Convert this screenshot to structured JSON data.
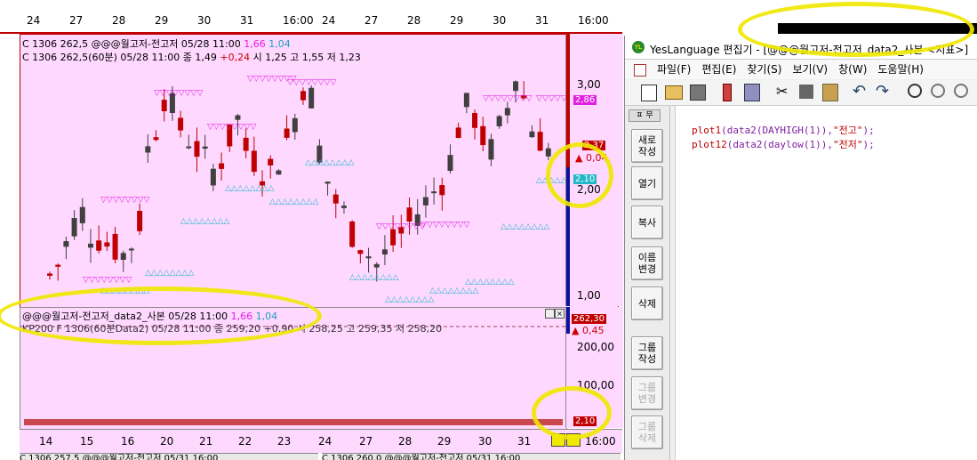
{
  "top_chart_axis": {
    "dates_left": [
      "24",
      "27",
      "28",
      "29",
      "30",
      "31",
      "16:00"
    ],
    "dates_right": [
      "24",
      "27",
      "28",
      "29",
      "30",
      "31",
      "16:00"
    ]
  },
  "main_chart": {
    "info_line1": {
      "prefix": "C 1306 262,5 @@@월고저-전고저 05/28 11:00",
      "v1": "1,66",
      "v2": "1,04"
    },
    "info_line2": {
      "prefix": "C 1306 262,5(60분) 05/28 11:00 종 1,49",
      "change": "+0,24",
      "rest": "시 1,25 고 1,55 저 1,23"
    },
    "y_ticks": [
      "3,00",
      "2,00",
      "1,00"
    ],
    "price_labels": {
      "top": "2,86",
      "upper": "2,37",
      "change": "▲ 0,04",
      "lower": "2,10"
    }
  },
  "lower_pane": {
    "title": {
      "prefix": "@@@월고저-전고저_data2_사본 05/28 11:00",
      "v1": "1,66",
      "v2": "1,04"
    },
    "kp_line": "KP200 F 1306(60분Data2) 05/28 11:00 종 259,20 +0,90 시 258,25 고 259,35 저 258,20",
    "y_ticks": [
      "200,00",
      "100,00"
    ],
    "price_labels": {
      "top": "262,30",
      "change": "▲ 0,45",
      "bottom": "2,10"
    }
  },
  "x_axis": {
    "dates": [
      "14",
      "15",
      "16",
      "20",
      "21",
      "22",
      "23",
      "24",
      "27",
      "28",
      "29",
      "30",
      "31",
      "16:00"
    ]
  },
  "bottom_tabs": {
    "left": "C 1306 257,5 @@@월고저-전고저 05/31 16:00",
    "right": "C 1306 260,0 @@@월고저-전고저 05/31 16:00"
  },
  "editor": {
    "title": "YesLanguage 편집기 - [@@@월고저-전고저_data2_사본 <지표>]",
    "menu": [
      "파일(F)",
      "편집(E)",
      "찾기(S)",
      "보기(V)",
      "창(W)",
      "도움말(H)"
    ],
    "sidebar_header": "ㅍ 무",
    "buttons": [
      "새로\n작성",
      "열기",
      "복사",
      "이름\n변경",
      "삭제",
      "그룹\n작성",
      "그룹\n변경",
      "그룹\n삭제"
    ],
    "code_lines": [
      {
        "fn": "plot1",
        "args": "(data2(DAYHIGH(1)),",
        "str": "\"전고\"",
        "end": ");"
      },
      {
        "fn": "plot12",
        "args": "(data2(daylow(1)),",
        "str": "\"전저\"",
        "end": ");"
      }
    ]
  },
  "colors": {
    "chart_bg": "#ffd8ff",
    "up_candle": "#c00000",
    "down_candle": "#404040",
    "magenta": "#e020e0",
    "cyan": "#20b8c8",
    "highlight": "#f0e800",
    "accent_blue": "#1010a0"
  }
}
